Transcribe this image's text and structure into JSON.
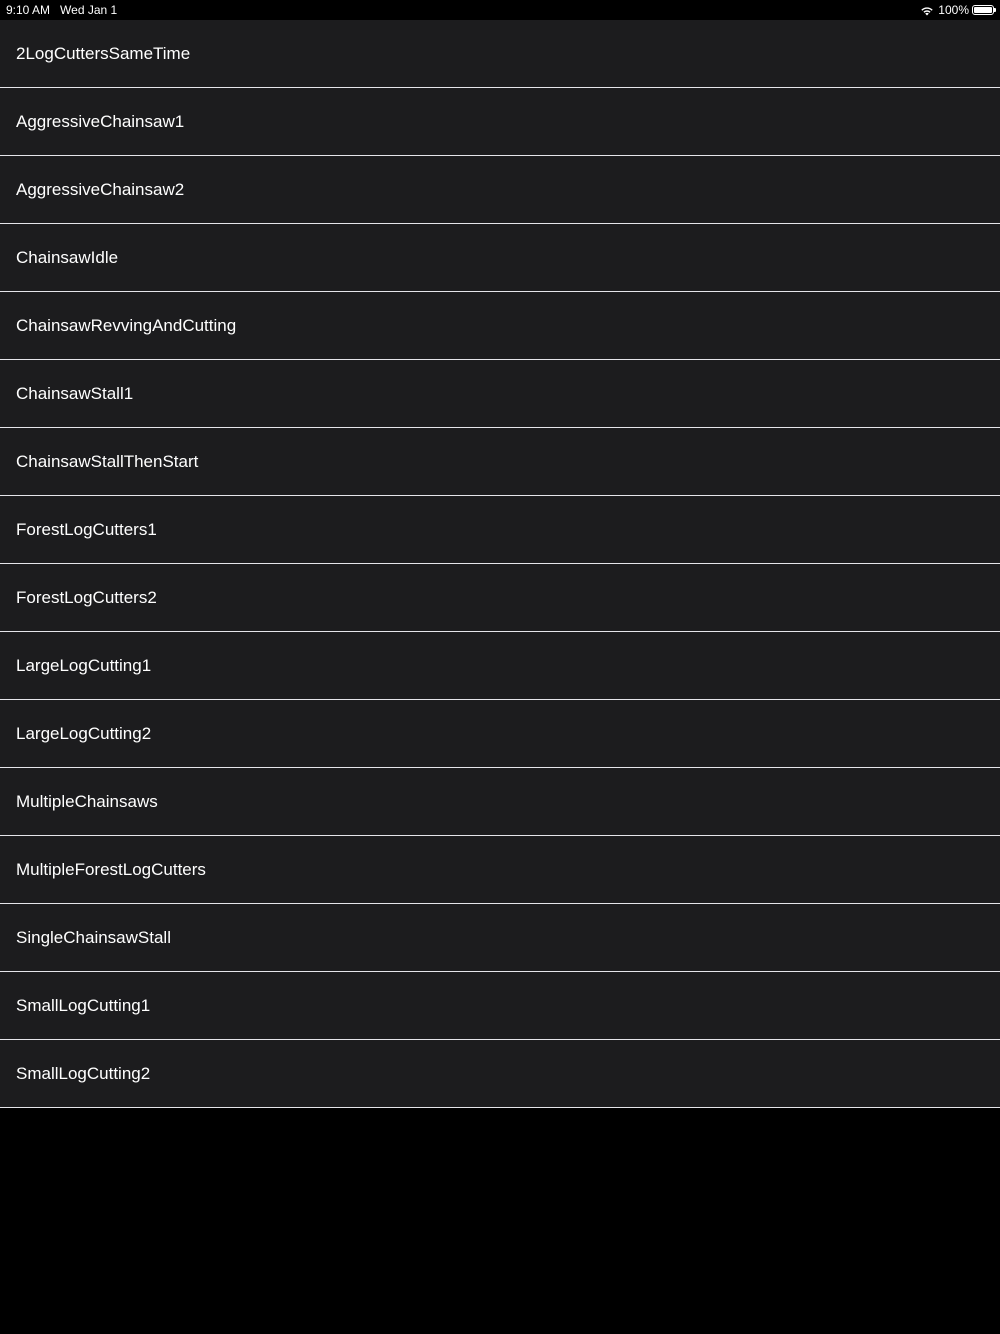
{
  "status_bar": {
    "time": "9:10 AM",
    "date": "Wed Jan 1",
    "battery_percent": "100%",
    "battery_level": 1.0,
    "icons": [
      "wifi-icon",
      "battery-icon"
    ]
  },
  "list": {
    "items": [
      {
        "label": "2LogCuttersSameTime"
      },
      {
        "label": "AggressiveChainsaw1"
      },
      {
        "label": "AggressiveChainsaw2"
      },
      {
        "label": "ChainsawIdle"
      },
      {
        "label": "ChainsawRevvingAndCutting"
      },
      {
        "label": "ChainsawStall1"
      },
      {
        "label": "ChainsawStallThenStart"
      },
      {
        "label": "ForestLogCutters1"
      },
      {
        "label": "ForestLogCutters2"
      },
      {
        "label": "LargeLogCutting1"
      },
      {
        "label": "LargeLogCutting2"
      },
      {
        "label": "MultipleChainsaws"
      },
      {
        "label": "MultipleForestLogCutters"
      },
      {
        "label": "SingleChainsawStall"
      },
      {
        "label": "SmallLogCutting1"
      },
      {
        "label": "SmallLogCutting2"
      }
    ]
  },
  "colors": {
    "background": "#000000",
    "cell_background": "#1c1c1e",
    "separator": "#e5e5ea",
    "text": "#ffffff"
  }
}
